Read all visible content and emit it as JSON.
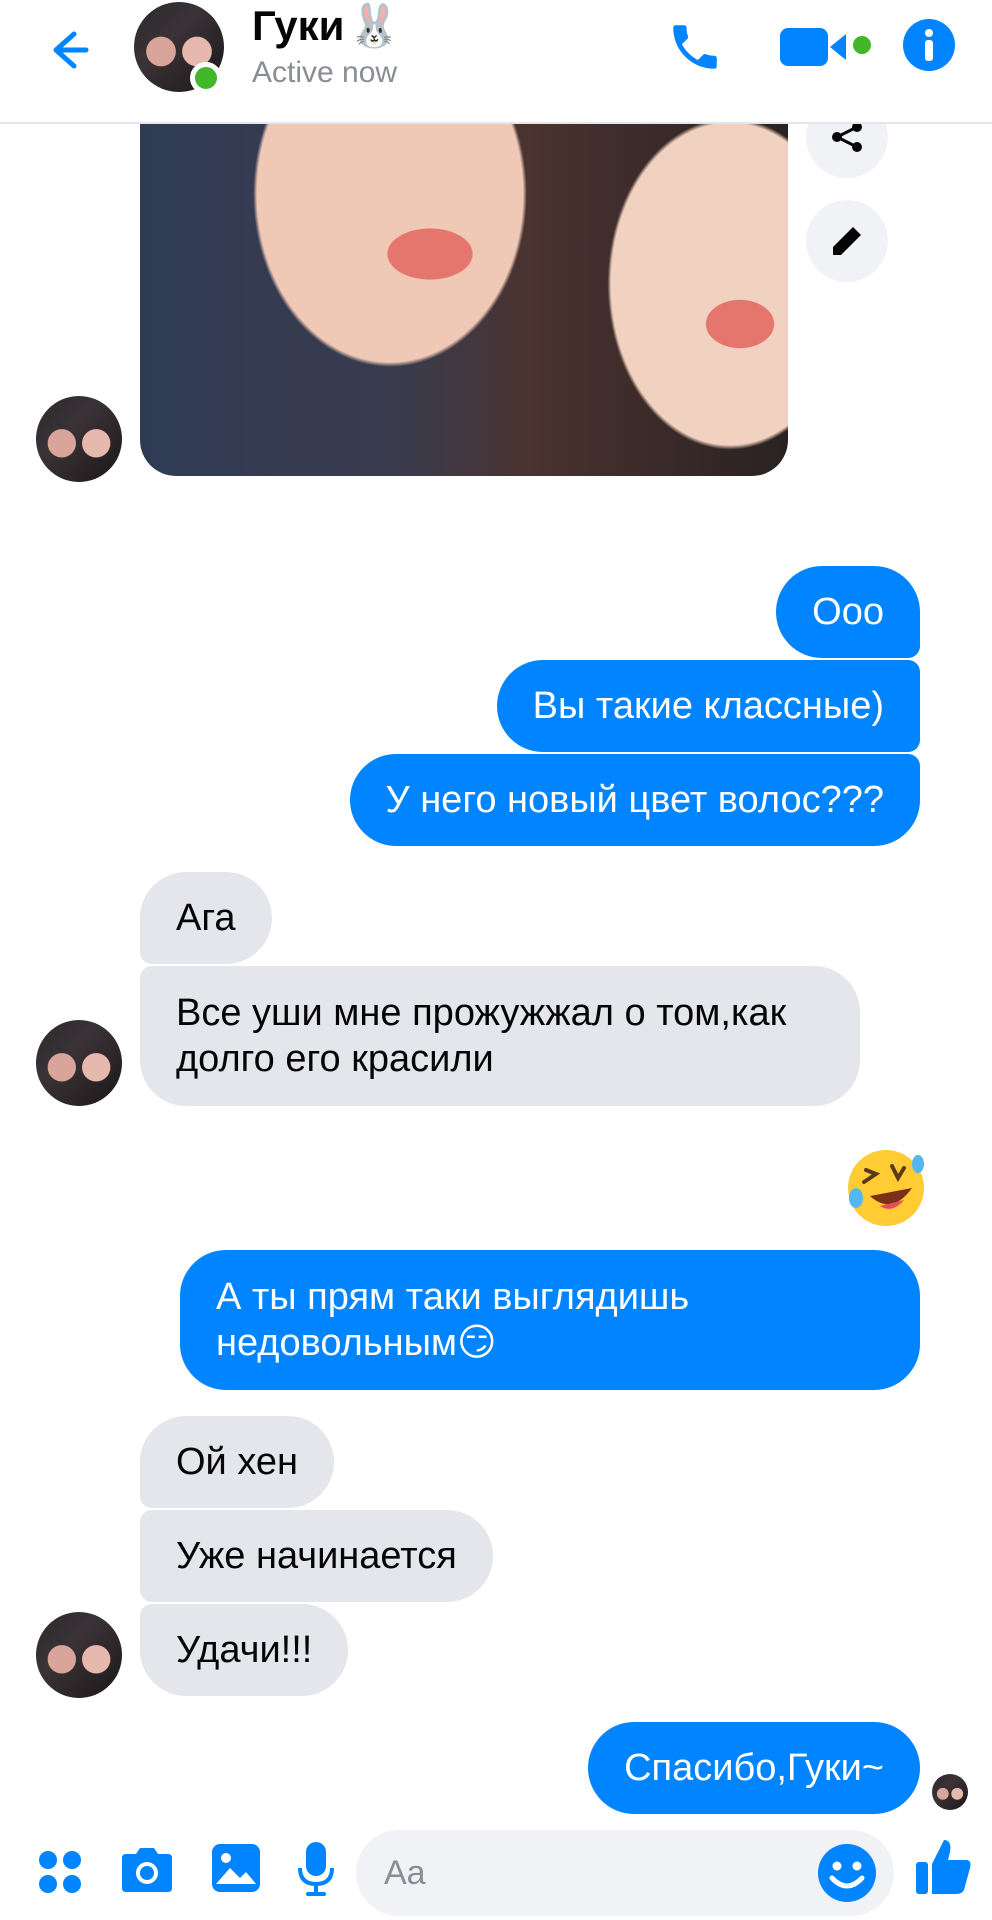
{
  "header": {
    "contact_name": "Гуки",
    "name_emoji": "🐰",
    "status": "Active now"
  },
  "messages": [
    {
      "side": "out",
      "text": "Ооо"
    },
    {
      "side": "out",
      "text": "Вы такие классные)"
    },
    {
      "side": "out",
      "text": "У него новый цвет волос???"
    },
    {
      "side": "in",
      "text": "Ага"
    },
    {
      "side": "in",
      "text": "Все уши мне прожужжал о том,как долго его красили"
    },
    {
      "side": "out",
      "text": "А ты прям таки выглядишь недовольным😏"
    },
    {
      "side": "in",
      "text": "Ой хен"
    },
    {
      "side": "in",
      "text": "Уже начинается"
    },
    {
      "side": "in",
      "text": "Удачи!!!"
    },
    {
      "side": "out",
      "text": "Спасибо,Гуки~"
    }
  ],
  "reaction_emoji": "🤣",
  "composer": {
    "placeholder": "Aa"
  },
  "colors": {
    "accent": "#0084ff",
    "incoming_bubble": "#e4e6eb",
    "online": "#42b72a"
  },
  "icons": [
    "back-arrow-icon",
    "phone-icon",
    "video-camera-icon",
    "info-icon",
    "share-icon",
    "pencil-icon",
    "apps-grid-icon",
    "camera-icon",
    "gallery-icon",
    "microphone-icon",
    "smiley-icon",
    "thumbs-up-icon"
  ]
}
